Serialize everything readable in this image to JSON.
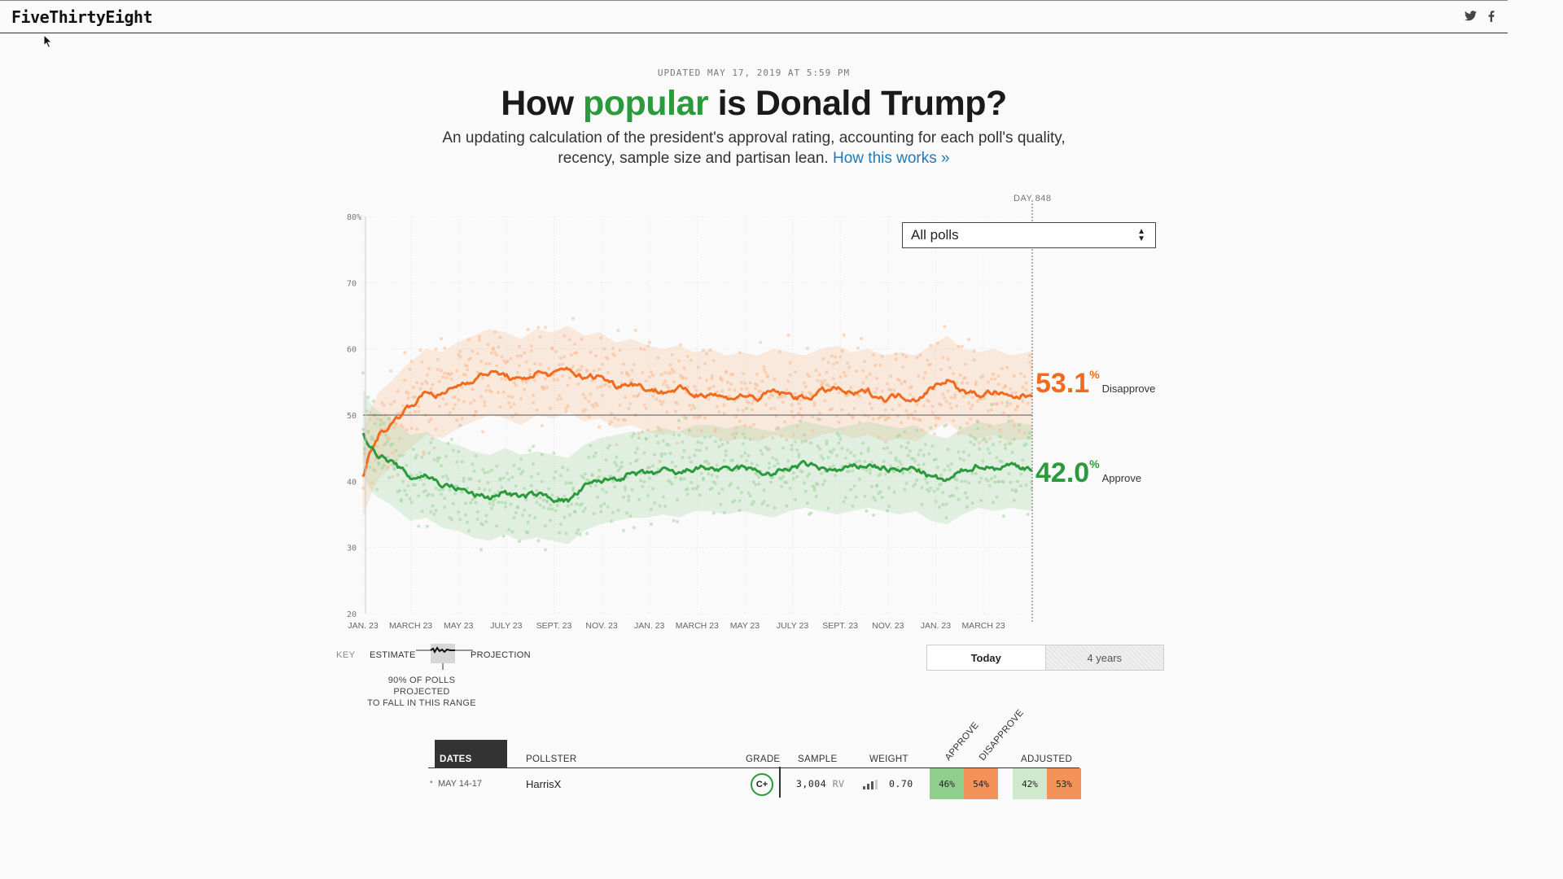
{
  "header": {
    "logo": "FiveThirtyEight",
    "social": [
      "twitter-icon",
      "facebook-icon"
    ]
  },
  "intro": {
    "updated": "UPDATED MAY 17, 2019 AT 5:59 PM",
    "title_prefix": "How ",
    "title_highlight": "popular",
    "title_suffix": " is Donald Trump?",
    "subtitle_line1": "An updating calculation of the president's approval rating, accounting for each poll's quality,",
    "subtitle_line2": "recency, sample size and partisan lean.",
    "how_link": "How this works »"
  },
  "controls": {
    "poll_filter": "All polls",
    "day_label": "DAY 848",
    "toggle_today": "Today",
    "toggle_4years": "4 years"
  },
  "readouts": {
    "disapprove_value": "53.1",
    "disapprove_label": "Disapprove",
    "approve_value": "42.0",
    "approve_label": "Approve",
    "pct": "%"
  },
  "key": {
    "label": "KEY",
    "estimate": "ESTIMATE",
    "projection": "PROJECTION",
    "note_line1": "90% OF POLLS PROJECTED",
    "note_line2": "TO FALL IN THIS RANGE"
  },
  "table": {
    "headers": {
      "dates": "DATES",
      "pollster": "POLLSTER",
      "grade": "GRADE",
      "sample": "SAMPLE",
      "weight": "WEIGHT",
      "approve": "APPROVE",
      "disapprove": "DISAPPROVE",
      "adjusted": "ADJUSTED"
    },
    "rows": [
      {
        "dates": "MAY 14-17",
        "pollster": "HarrisX",
        "grade": "C+",
        "sample": "3,004",
        "sample_type": "RV",
        "weight": "0.70",
        "approve": "46%",
        "disapprove": "54%",
        "adj_approve": "42%",
        "adj_disapprove": "53%"
      }
    ]
  },
  "colors": {
    "approve": "#2b9a3c",
    "disapprove": "#f26a1b",
    "link": "#1f7ab8"
  },
  "chart_data": {
    "type": "line",
    "y_ticks": [
      "80%",
      "70",
      "60",
      "50",
      "40",
      "30",
      "20"
    ],
    "ylim": [
      20,
      80
    ],
    "x_ticks": [
      "JAN. 23",
      "MARCH 23",
      "MAY 23",
      "JULY 23",
      "SEPT. 23",
      "NOV. 23",
      "JAN. 23",
      "MARCH 23",
      "MAY 23",
      "JULY 23",
      "SEPT. 23",
      "NOV. 23",
      "JAN. 23",
      "MARCH 23"
    ],
    "xlim_days": [
      0,
      848
    ],
    "series": [
      {
        "name": "Disapprove",
        "x_days": [
          0,
          10,
          20,
          35,
          50,
          60,
          80,
          100,
          120,
          140,
          160,
          180,
          200,
          220,
          240,
          260,
          280,
          300,
          320,
          340,
          360,
          380,
          400,
          420,
          440,
          460,
          480,
          500,
          520,
          540,
          560,
          580,
          600,
          620,
          640,
          660,
          680,
          700,
          720,
          740,
          760,
          780,
          800,
          820,
          848
        ],
        "values": [
          41.0,
          44.5,
          47.0,
          48.5,
          50.5,
          51.5,
          53.5,
          53.0,
          54.5,
          55.5,
          56.5,
          56.0,
          55.0,
          56.5,
          56.0,
          57.0,
          55.5,
          56.0,
          54.5,
          55.0,
          54.0,
          53.5,
          54.0,
          53.0,
          53.5,
          52.5,
          53.0,
          52.5,
          53.5,
          53.0,
          52.5,
          53.5,
          54.0,
          53.0,
          53.5,
          52.5,
          53.0,
          52.5,
          54.0,
          55.5,
          53.5,
          53.0,
          53.5,
          52.5,
          53.1
        ]
      },
      {
        "name": "Approve",
        "x_days": [
          0,
          10,
          20,
          35,
          50,
          60,
          80,
          100,
          120,
          140,
          160,
          180,
          200,
          220,
          240,
          260,
          280,
          300,
          320,
          340,
          360,
          380,
          400,
          420,
          440,
          460,
          480,
          500,
          520,
          540,
          560,
          580,
          600,
          620,
          640,
          660,
          680,
          700,
          720,
          740,
          760,
          780,
          800,
          820,
          848
        ],
        "values": [
          47.5,
          45.0,
          44.0,
          43.0,
          41.5,
          40.5,
          41.0,
          39.5,
          39.0,
          38.0,
          37.5,
          38.5,
          37.5,
          38.0,
          37.5,
          37.0,
          39.0,
          40.0,
          40.5,
          41.0,
          41.0,
          41.5,
          41.0,
          42.0,
          42.0,
          41.5,
          42.0,
          41.5,
          41.0,
          42.0,
          42.5,
          42.0,
          41.5,
          42.0,
          42.5,
          42.0,
          41.5,
          42.0,
          40.5,
          40.0,
          41.5,
          42.5,
          42.0,
          42.5,
          42.0
        ]
      }
    ],
    "reference_line": 50,
    "grid": true
  }
}
